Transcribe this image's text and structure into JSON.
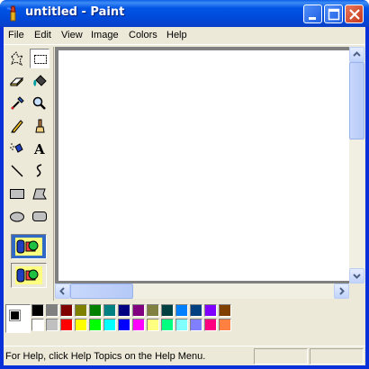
{
  "window": {
    "title": "untitled - Paint"
  },
  "menu": [
    "File",
    "Edit",
    "View",
    "Image",
    "Colors",
    "Help"
  ],
  "toolbox": {
    "tools": [
      "free-form-select-icon",
      "select-icon",
      "eraser-icon",
      "fill-with-color-icon",
      "pick-color-icon",
      "magnifier-icon",
      "pencil-icon",
      "brush-icon",
      "airbrush-icon",
      "text-icon",
      "line-icon",
      "curve-icon",
      "rectangle-icon",
      "polygon-icon",
      "ellipse-icon",
      "rounded-rectangle-icon"
    ],
    "selected_tool": "select-icon"
  },
  "colors": {
    "foreground": "#000000",
    "background": "#ffffff",
    "palette_row1": [
      "#000000",
      "#808080",
      "#800000",
      "#808000",
      "#008000",
      "#008080",
      "#000080",
      "#800080",
      "#808040",
      "#004040",
      "#0080ff",
      "#004080",
      "#8000ff",
      "#804000"
    ],
    "palette_row2": [
      "#ffffff",
      "#c0c0c0",
      "#ff0000",
      "#ffff00",
      "#00ff00",
      "#00ffff",
      "#0000ff",
      "#ff00ff",
      "#ffff80",
      "#00ff80",
      "#80ffff",
      "#8080ff",
      "#ff0080",
      "#ff8040"
    ]
  },
  "status": {
    "text": "For Help, click Help Topics on the Help Menu."
  }
}
